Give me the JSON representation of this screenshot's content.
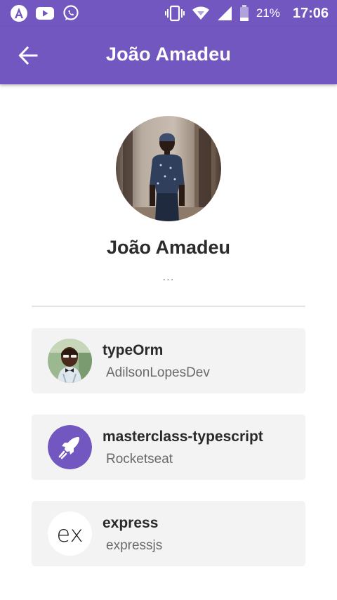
{
  "status_bar": {
    "left_icons": [
      "angular-icon",
      "youtube-icon",
      "whatsapp-icon"
    ],
    "right_icons": [
      "vibrate-icon",
      "wifi-icon",
      "signal-icon",
      "battery-icon"
    ],
    "battery": "21%",
    "time": "17:06"
  },
  "header": {
    "back_icon": "arrow-back-icon",
    "title": "João Amadeu"
  },
  "profile": {
    "name": "João Amadeu",
    "bio": "..."
  },
  "repositories": [
    {
      "name": "typeOrm",
      "owner": "AdilsonLopesDev"
    },
    {
      "name": "masterclass-typescript",
      "owner": "Rocketseat"
    },
    {
      "name": "express",
      "owner": "expressjs",
      "logo_text": "ex"
    }
  ],
  "colors": {
    "primary": "#7357c0",
    "card_background": "#f3f3f3",
    "divider": "#e4e4e4",
    "rocketseat": "#7357c0"
  }
}
